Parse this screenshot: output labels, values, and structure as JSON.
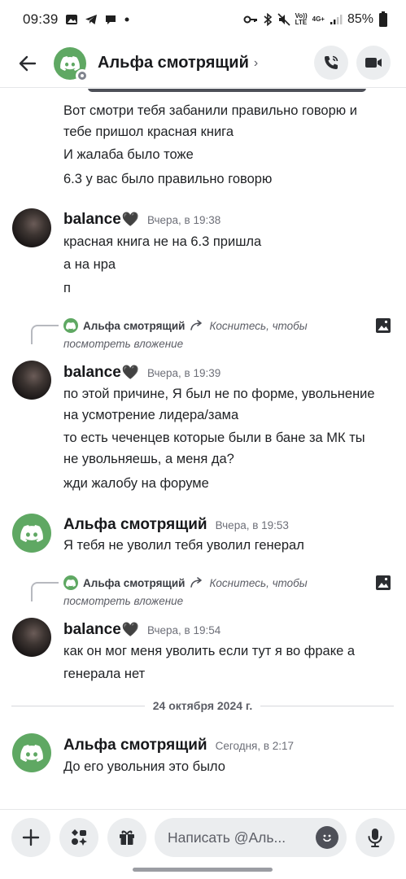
{
  "status_bar": {
    "time": "09:39",
    "net_top": "Vo))",
    "net_bottom": "LTE",
    "net2_top": "4G+",
    "net2_bottom": "",
    "battery": "85%"
  },
  "header": {
    "channel_name": "Альфа смотрящий",
    "chevron": "›"
  },
  "messages": {
    "lines_top": [
      "Вот смотри тебя забанили правильно говорю и",
      "тебе пришол красная книга",
      "И жалаба было тоже",
      "6.3 у вас было правильно говорю"
    ],
    "m1": {
      "author": "balance",
      "heart": "🖤",
      "timestamp": "Вчера, в 19:38",
      "lines": [
        "красная книга не на 6.3 пришла",
        "а на нра",
        "п"
      ]
    },
    "reply1": {
      "author": "Альфа смотрящий",
      "hint": "Коснитесь, чтобы",
      "hint2": "посмотреть вложение"
    },
    "m2": {
      "author": "balance",
      "heart": "🖤",
      "timestamp": "Вчера, в 19:39",
      "lines": [
        "по этой причине, Я был не по форме, увольнение",
        "на усмотрение лидера/зама",
        "то есть чеченцев которые были в бане за МК ты",
        "не увольняешь, а меня да?",
        "жди жалобу на форуме"
      ]
    },
    "m3": {
      "author": "Альфа смотрящий",
      "timestamp": "Вчера, в 19:53",
      "lines": [
        "Я тебя не уволил тебя уволил генерал"
      ]
    },
    "reply2": {
      "author": "Альфа смотрящий",
      "hint": "Коснитесь, чтобы",
      "hint2": "посмотреть вложение"
    },
    "m4": {
      "author": "balance",
      "heart": "🖤",
      "timestamp": "Вчера, в 19:54",
      "lines": [
        "как он мог меня уволить если тут я во фраке а",
        "генерала нет"
      ]
    },
    "date_divider": "24 октября 2024 г.",
    "m5": {
      "author": "Альфа смотрящий",
      "timestamp": "Сегодня, в 2:17",
      "lines": [
        "До его увольния это было"
      ]
    }
  },
  "input": {
    "placeholder": "Написать @Аль..."
  },
  "colors": {
    "discord_green": "#5fa863",
    "button_bg": "#ebedef",
    "text": "#1f2124",
    "muted": "#6d6f78"
  }
}
